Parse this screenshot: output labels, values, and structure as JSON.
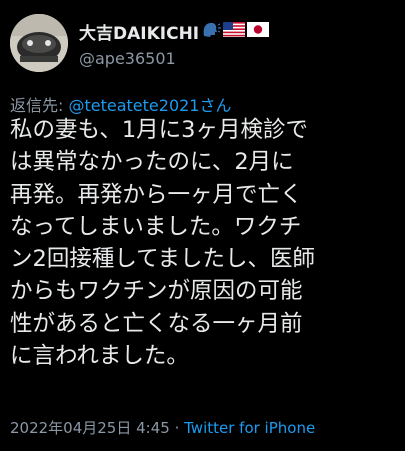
{
  "user": {
    "display_name": "大吉DAIKICHI",
    "handle": "@ape36501",
    "name_emojis": [
      "speaking-head-emoji",
      "us-flag-emoji",
      "japan-flag-emoji"
    ]
  },
  "reply": {
    "prefix": "返信先: ",
    "target": "@teteatete2021さん"
  },
  "tweet": {
    "lines": [
      "私の妻も、1月に3ヶ月検診で",
      "は異常なかったのに、2月に",
      "再発。再発から一ヶ月で亡く",
      "なってしまいました。ワクチ",
      "ン2回接種してましたし、医師",
      "からもワクチンが原因の可能",
      "性があると亡くなる一ヶ月前",
      "に言われました。"
    ]
  },
  "meta": {
    "timestamp": "2022年04月25日 4:45",
    "separator": " · ",
    "source": "Twitter for iPhone"
  },
  "colors": {
    "background": "#000000",
    "text": "#e7e9ea",
    "secondary": "#8b98a5",
    "link": "#1d9bf0"
  }
}
